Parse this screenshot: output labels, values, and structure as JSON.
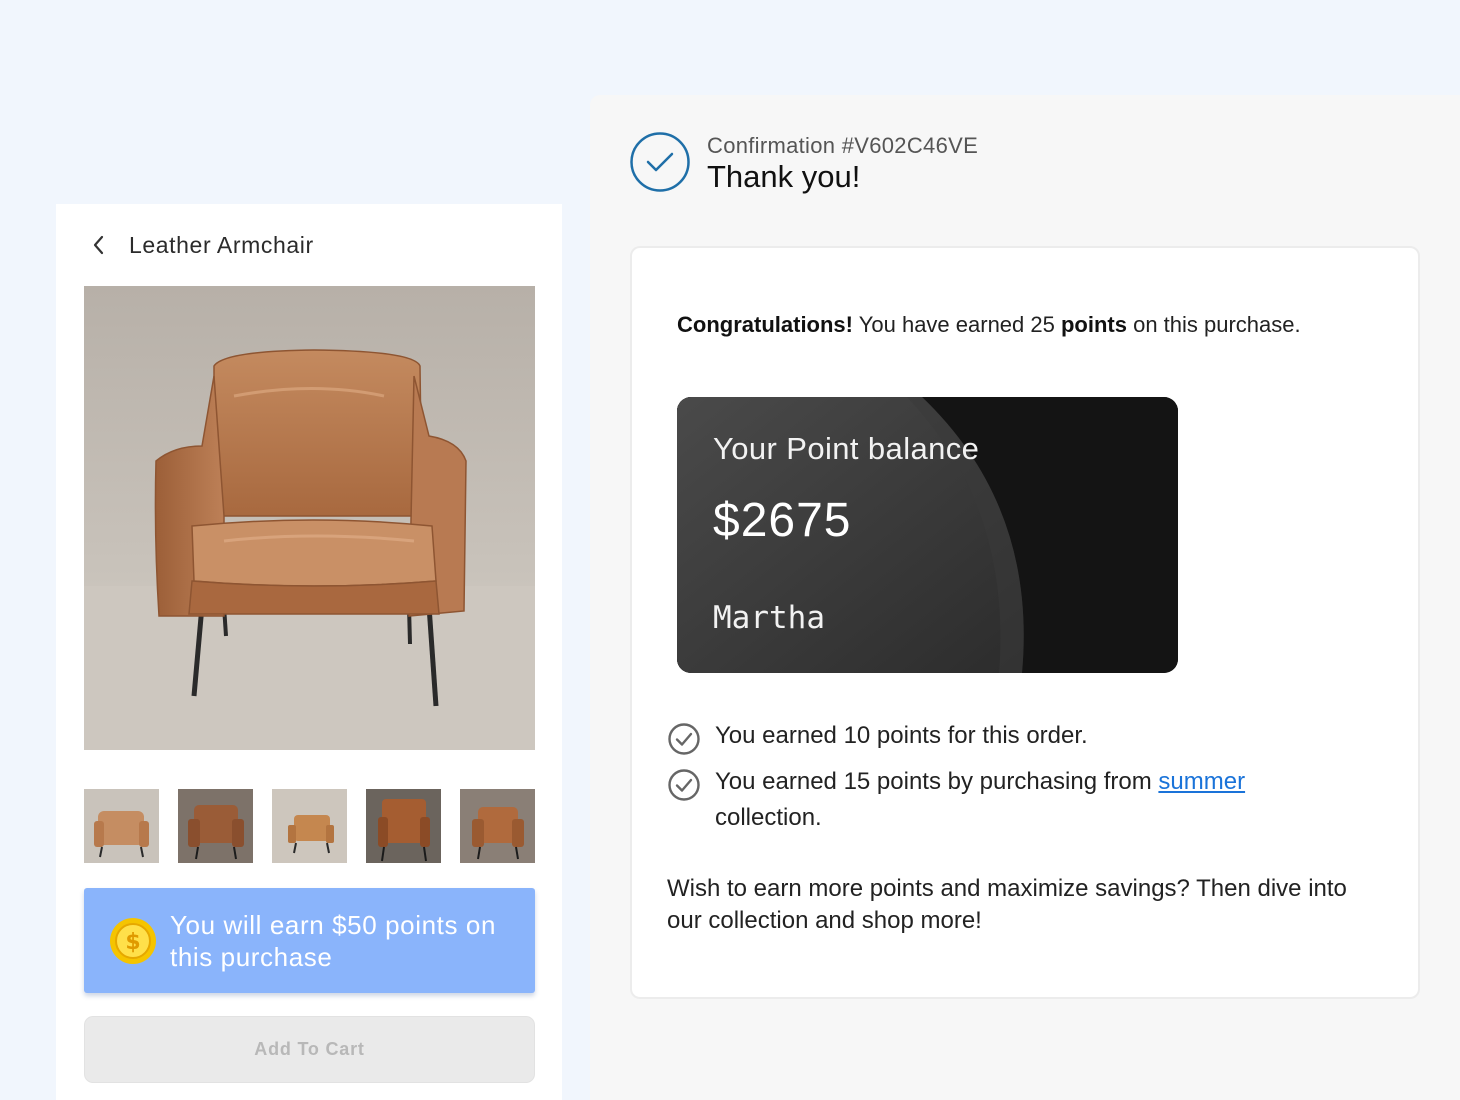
{
  "product": {
    "title": "Leather Armchair",
    "earn_banner": "You will earn $50 points on this purchase",
    "add_to_cart_label": "Add To Cart",
    "thumbnail_count": 5
  },
  "confirmation": {
    "number_label": "Confirmation #V602C46VE",
    "title": "Thank you!",
    "congrats_bold": "Congratulations!",
    "congrats_text_1": " You have earned 25 ",
    "congrats_points_bold": "points",
    "congrats_text_2": " on this purchase.",
    "balance": {
      "label": "Your Point balance",
      "amount": "$2675",
      "name": "Martha"
    },
    "earned_items": [
      {
        "text": "You earned  10 points for this order."
      },
      {
        "text_before": "You earned 15 points by purchasing from ",
        "link": "summer",
        "text_after": " collection."
      }
    ],
    "more_text": "Wish to earn more points and maximize savings? Then dive into our collection and shop more!"
  },
  "colors": {
    "page_bg": "#f1f6fd",
    "banner_bg": "#8ab4fb",
    "accent_blue": "#1f6fa8",
    "link_blue": "#1a73d9",
    "leather": "#b87a52"
  },
  "icons": {
    "back": "chevron-left-icon",
    "coin": "coin-icon",
    "confirm": "check-circle-icon",
    "earned": "check-circle-gray-icon"
  }
}
